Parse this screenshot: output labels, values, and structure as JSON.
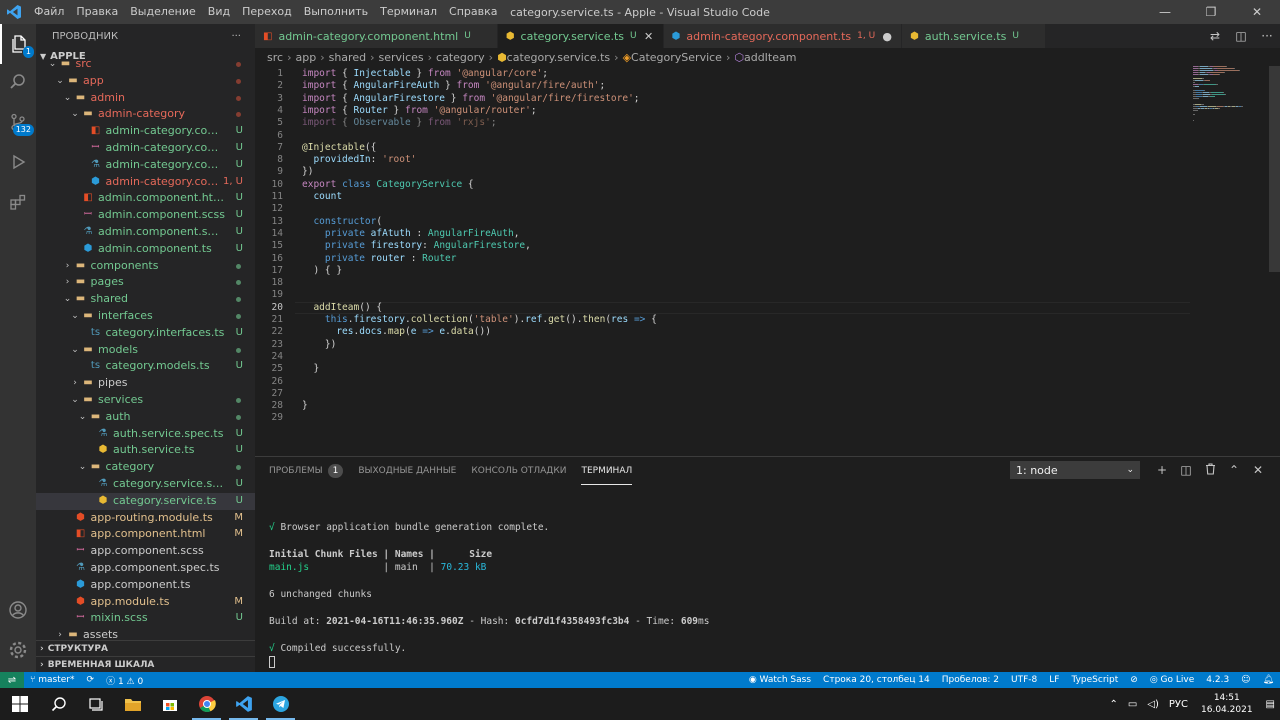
{
  "titlebar": {
    "menu": [
      "Файл",
      "Правка",
      "Выделение",
      "Вид",
      "Переход",
      "Выполнить",
      "Терминал",
      "Справка"
    ],
    "title": "category.service.ts - Apple - Visual Studio Code",
    "controls": [
      "—",
      "❐",
      "✕"
    ]
  },
  "activity": {
    "badge": "132"
  },
  "sidebar": {
    "header": "ПРОВОДНИК",
    "more": "···",
    "root": "APPLE",
    "tree": [
      {
        "name": "src",
        "depth": 1,
        "kind": "folder",
        "open": true,
        "status": "dot",
        "color": "red"
      },
      {
        "name": "app",
        "depth": 2,
        "kind": "folder",
        "open": true,
        "status": "dot",
        "color": "red"
      },
      {
        "name": "admin",
        "depth": 3,
        "kind": "folder",
        "open": true,
        "status": "dot",
        "color": "red"
      },
      {
        "name": "admin-category",
        "depth": 4,
        "kind": "folder",
        "open": true,
        "status": "dot",
        "color": "red"
      },
      {
        "name": "admin-category.componen...",
        "depth": 5,
        "kind": "html",
        "status": "U",
        "color": "green"
      },
      {
        "name": "admin-category.componen...",
        "depth": 5,
        "kind": "scss",
        "status": "U",
        "color": "green"
      },
      {
        "name": "admin-category.componen...",
        "depth": 5,
        "kind": "spec",
        "status": "U",
        "color": "green"
      },
      {
        "name": "admin-category.compon...",
        "depth": 5,
        "kind": "angular",
        "status": "1, U",
        "color": "red"
      },
      {
        "name": "admin.component.html",
        "depth": 4,
        "kind": "html",
        "status": "U",
        "color": "green"
      },
      {
        "name": "admin.component.scss",
        "depth": 4,
        "kind": "scss",
        "status": "U",
        "color": "green"
      },
      {
        "name": "admin.component.spec.ts",
        "depth": 4,
        "kind": "spec",
        "status": "U",
        "color": "green"
      },
      {
        "name": "admin.component.ts",
        "depth": 4,
        "kind": "angular",
        "status": "U",
        "color": "green"
      },
      {
        "name": "components",
        "depth": 3,
        "kind": "folder",
        "open": false,
        "status": "dot",
        "color": "green"
      },
      {
        "name": "pages",
        "depth": 3,
        "kind": "folder",
        "open": false,
        "status": "dot",
        "color": "green"
      },
      {
        "name": "shared",
        "depth": 3,
        "kind": "folder",
        "open": true,
        "status": "dot",
        "color": "green"
      },
      {
        "name": "interfaces",
        "depth": 4,
        "kind": "folder",
        "open": true,
        "status": "dot",
        "color": "green"
      },
      {
        "name": "category.interfaces.ts",
        "depth": 5,
        "kind": "ts",
        "status": "U",
        "color": "green"
      },
      {
        "name": "models",
        "depth": 4,
        "kind": "folder",
        "open": true,
        "status": "dot",
        "color": "green"
      },
      {
        "name": "category.models.ts",
        "depth": 5,
        "kind": "ts",
        "status": "U",
        "color": "green"
      },
      {
        "name": "pipes",
        "depth": 4,
        "kind": "folder",
        "open": false,
        "status": "",
        "color": "plain"
      },
      {
        "name": "services",
        "depth": 4,
        "kind": "folder",
        "open": true,
        "status": "dot",
        "color": "green"
      },
      {
        "name": "auth",
        "depth": 5,
        "kind": "folder",
        "open": true,
        "status": "dot",
        "color": "green"
      },
      {
        "name": "auth.service.spec.ts",
        "depth": 6,
        "kind": "spec",
        "status": "U",
        "color": "green"
      },
      {
        "name": "auth.service.ts",
        "depth": 6,
        "kind": "service",
        "status": "U",
        "color": "green"
      },
      {
        "name": "category",
        "depth": 5,
        "kind": "folder",
        "open": true,
        "status": "dot",
        "color": "green"
      },
      {
        "name": "category.service.spec.ts",
        "depth": 6,
        "kind": "spec",
        "status": "U",
        "color": "green"
      },
      {
        "name": "category.service.ts",
        "depth": 6,
        "kind": "service",
        "status": "U",
        "color": "green",
        "selected": true
      },
      {
        "name": "app-routing.module.ts",
        "depth": 3,
        "kind": "module",
        "status": "M",
        "color": "orange"
      },
      {
        "name": "app.component.html",
        "depth": 3,
        "kind": "html",
        "status": "M",
        "color": "orange"
      },
      {
        "name": "app.component.scss",
        "depth": 3,
        "kind": "scss",
        "status": "",
        "color": "plain"
      },
      {
        "name": "app.component.spec.ts",
        "depth": 3,
        "kind": "spec",
        "status": "",
        "color": "plain"
      },
      {
        "name": "app.component.ts",
        "depth": 3,
        "kind": "angular",
        "status": "",
        "color": "plain"
      },
      {
        "name": "app.module.ts",
        "depth": 3,
        "kind": "module",
        "status": "M",
        "color": "orange"
      },
      {
        "name": "mixin.scss",
        "depth": 3,
        "kind": "scss",
        "status": "U",
        "color": "green"
      },
      {
        "name": "assets",
        "depth": 2,
        "kind": "folder",
        "open": false,
        "status": "",
        "color": "plain"
      }
    ],
    "outline": "СТРУКТУРА",
    "timeline": "ВРЕМЕННАЯ ШКАЛА"
  },
  "tabs": [
    {
      "label": "admin-category.component.html",
      "kind": "html",
      "status": "U",
      "color": "green",
      "active": false
    },
    {
      "label": "category.service.ts",
      "kind": "service",
      "status": "U",
      "color": "green",
      "active": true,
      "close": "✕"
    },
    {
      "label": "admin-category.component.ts",
      "kind": "angular",
      "status": "1, U",
      "color": "red",
      "active": false,
      "close": "●"
    },
    {
      "label": "auth.service.ts",
      "kind": "service",
      "status": "U",
      "color": "green",
      "active": false
    }
  ],
  "breadcrumb": [
    "src",
    "app",
    "shared",
    "services",
    "category",
    "category.service.ts",
    "CategoryService",
    "addIteam"
  ],
  "editor": {
    "current_line": 20,
    "lines": [
      [
        [
          "k",
          "import"
        ],
        [
          "p",
          " { "
        ],
        [
          "v",
          "Injectable"
        ],
        [
          "p",
          " } "
        ],
        [
          "k",
          "from"
        ],
        [
          "s",
          " '@angular/core'"
        ],
        [
          "p",
          ";"
        ]
      ],
      [
        [
          "k",
          "import"
        ],
        [
          "p",
          " { "
        ],
        [
          "v",
          "AngularFireAuth"
        ],
        [
          "p",
          " } "
        ],
        [
          "k",
          "from"
        ],
        [
          "s",
          " '@angular/fire/auth'"
        ],
        [
          "p",
          ";"
        ]
      ],
      [
        [
          "k",
          "import"
        ],
        [
          "p",
          " { "
        ],
        [
          "v",
          "AngularFirestore"
        ],
        [
          "p",
          " } "
        ],
        [
          "k",
          "from"
        ],
        [
          "s",
          " '@angular/fire/firestore'"
        ],
        [
          "p",
          ";"
        ]
      ],
      [
        [
          "k",
          "import"
        ],
        [
          "p",
          " { "
        ],
        [
          "v",
          "Router"
        ],
        [
          "p",
          " } "
        ],
        [
          "k",
          "from"
        ],
        [
          "s",
          " '@angular/router'"
        ],
        [
          "p",
          ";"
        ]
      ],
      [
        [
          "kd",
          "import"
        ],
        [
          "pd",
          " { "
        ],
        [
          "vd",
          "Observable"
        ],
        [
          "pd",
          " } "
        ],
        [
          "kd",
          "from"
        ],
        [
          "sd",
          " 'rxjs'"
        ],
        [
          "pd",
          ";"
        ]
      ],
      [],
      [
        [
          "f",
          "@Injectable"
        ],
        [
          "p",
          "({"
        ]
      ],
      [
        [
          "p",
          "  "
        ],
        [
          "v",
          "providedIn"
        ],
        [
          "p",
          ": "
        ],
        [
          "s",
          "'root'"
        ]
      ],
      [
        [
          "p",
          "})"
        ]
      ],
      [
        [
          "k",
          "export"
        ],
        [
          "p",
          " "
        ],
        [
          "b",
          "class"
        ],
        [
          "p",
          " "
        ],
        [
          "t",
          "CategoryService"
        ],
        [
          "p",
          " {"
        ]
      ],
      [
        [
          "p",
          "  "
        ],
        [
          "v",
          "count"
        ]
      ],
      [],
      [
        [
          "p",
          "  "
        ],
        [
          "b",
          "constructor"
        ],
        [
          "p",
          "("
        ]
      ],
      [
        [
          "p",
          "    "
        ],
        [
          "b",
          "private"
        ],
        [
          "p",
          " "
        ],
        [
          "v",
          "afAtuth"
        ],
        [
          "p",
          " : "
        ],
        [
          "t",
          "AngularFireAuth"
        ],
        [
          "p",
          ","
        ]
      ],
      [
        [
          "p",
          "    "
        ],
        [
          "b",
          "private"
        ],
        [
          "p",
          " "
        ],
        [
          "v",
          "firestory"
        ],
        [
          "p",
          ": "
        ],
        [
          "t",
          "AngularFirestore"
        ],
        [
          "p",
          ","
        ]
      ],
      [
        [
          "p",
          "    "
        ],
        [
          "b",
          "private"
        ],
        [
          "p",
          " "
        ],
        [
          "v",
          "router"
        ],
        [
          "p",
          " : "
        ],
        [
          "t",
          "Router"
        ]
      ],
      [
        [
          "p",
          "  ) { }"
        ]
      ],
      [],
      [],
      [
        [
          "p",
          "  "
        ],
        [
          "f",
          "addIteam"
        ],
        [
          "p",
          "() {"
        ]
      ],
      [
        [
          "p",
          "    "
        ],
        [
          "b",
          "this"
        ],
        [
          "p",
          "."
        ],
        [
          "v",
          "firestory"
        ],
        [
          "p",
          "."
        ],
        [
          "f",
          "collection"
        ],
        [
          "p",
          "("
        ],
        [
          "s",
          "'table'"
        ],
        [
          "p",
          ")."
        ],
        [
          "v",
          "ref"
        ],
        [
          "p",
          "."
        ],
        [
          "f",
          "get"
        ],
        [
          "p",
          "()."
        ],
        [
          "f",
          "then"
        ],
        [
          "p",
          "("
        ],
        [
          "v",
          "res"
        ],
        [
          "p",
          " "
        ],
        [
          "b",
          "=>"
        ],
        [
          "p",
          " {"
        ]
      ],
      [
        [
          "p",
          "      "
        ],
        [
          "v",
          "res"
        ],
        [
          "p",
          "."
        ],
        [
          "v",
          "docs"
        ],
        [
          "p",
          "."
        ],
        [
          "f",
          "map"
        ],
        [
          "p",
          "("
        ],
        [
          "v",
          "e"
        ],
        [
          "p",
          " "
        ],
        [
          "b",
          "=>"
        ],
        [
          "p",
          " "
        ],
        [
          "v",
          "e"
        ],
        [
          "p",
          "."
        ],
        [
          "f",
          "data"
        ],
        [
          "p",
          "())"
        ]
      ],
      [
        [
          "p",
          "    })"
        ]
      ],
      [],
      [
        [
          "p",
          "  }"
        ]
      ],
      [],
      [],
      [
        [
          "p",
          "}"
        ]
      ],
      []
    ]
  },
  "panel": {
    "tabs": [
      "ПРОБЛЕМЫ",
      "ВЫХОДНЫЕ ДАННЫЕ",
      "КОНСОЛЬ ОТЛАДКИ",
      "ТЕРМИНАЛ"
    ],
    "problems_count": "1",
    "active_tab": 3,
    "terminal_select": "1: node"
  },
  "terminal": {
    "bundle_ok": "Browser application bundle generation complete.",
    "table_header": [
      "Initial Chunk Files",
      "Names",
      "Size"
    ],
    "table_row": [
      "main.js",
      "main",
      "70.23 kB"
    ],
    "unchanged": "6 unchanged chunks",
    "build_at_label": "Build at: ",
    "build_at": "2021-04-16T11:46:35.960Z",
    "hash_label": " - Hash: ",
    "hash": "0cfd7d1f4358493fc3b4",
    "time_label": " - Time: ",
    "time": "609",
    "time_unit": "ms",
    "compiled": "Compiled successfully."
  },
  "statusbar": {
    "branch": "master*",
    "errors": "1",
    "warnings": "0",
    "right": [
      "Watch Sass",
      "Строка 20, столбец 14",
      "Пробелов: 2",
      "UTF-8",
      "LF",
      "TypeScript",
      "Go Live",
      "4.2.3"
    ]
  },
  "taskbar": {
    "lang": "РУС",
    "time": "14:51",
    "date": "16.04.2021"
  },
  "colors": {
    "accent": "#007acc",
    "git_untracked": "#73c991",
    "git_modified": "#e2c08d",
    "git_error": "#e5695a"
  }
}
